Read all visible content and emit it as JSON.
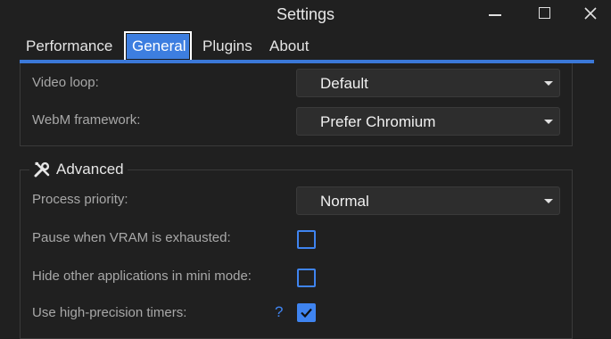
{
  "window": {
    "title": "Settings",
    "minimize_icon": "minimize-icon",
    "maximize_icon": "maximize-icon",
    "close_icon": "close-icon",
    "close_glyph": "✕"
  },
  "tabs": [
    {
      "label": "Performance",
      "selected": false
    },
    {
      "label": "General",
      "selected": true
    },
    {
      "label": "Plugins",
      "selected": false
    },
    {
      "label": "About",
      "selected": false
    }
  ],
  "accent_color": "#3b78d8",
  "general": {
    "video_loop": {
      "label": "Video loop:",
      "value": "Default"
    },
    "webm_framework": {
      "label": "WebM framework:",
      "value": "Prefer Chromium"
    }
  },
  "advanced": {
    "title": "Advanced",
    "icon": "tools-icon",
    "process_priority": {
      "label": "Process priority:",
      "value": "Normal"
    },
    "pause_vram": {
      "label": "Pause when VRAM is exhausted:",
      "checked": false
    },
    "hide_other_apps": {
      "label": "Hide other applications in mini mode:",
      "checked": false
    },
    "high_precision_timers": {
      "label": "Use high-precision timers:",
      "help": "?",
      "checked": true
    }
  }
}
